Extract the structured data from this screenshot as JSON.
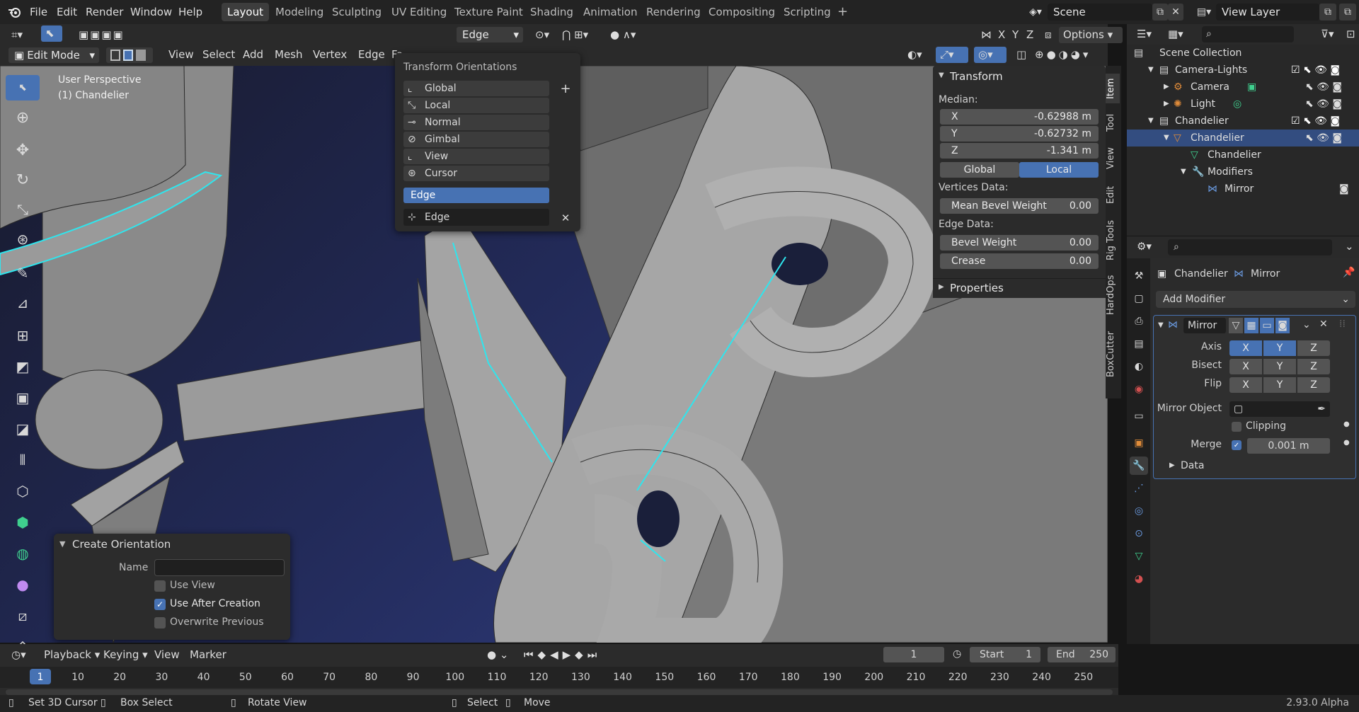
{
  "menu": {
    "items": [
      "File",
      "Edit",
      "Render",
      "Window",
      "Help"
    ]
  },
  "workspaces": [
    "Layout",
    "Modeling",
    "Sculpting",
    "UV Editing",
    "Texture Paint",
    "Shading",
    "Animation",
    "Rendering",
    "Compositing",
    "Scripting"
  ],
  "scene": {
    "label": "Scene",
    "view_layer": "View Layer"
  },
  "viewport_header": {
    "mode": "Edit Mode",
    "menus": [
      "View",
      "Select",
      "Add",
      "Mesh",
      "Vertex",
      "Edge",
      "Fa"
    ],
    "orientation": "Edge",
    "options": "Options",
    "axes": [
      "X",
      "Y",
      "Z"
    ]
  },
  "viewport_overlay": {
    "perspective": "User Perspective",
    "object": "(1) Chandelier"
  },
  "orientations_popup": {
    "title": "Transform Orientations",
    "items": [
      "Global",
      "Local",
      "Normal",
      "Gimbal",
      "View",
      "Cursor"
    ],
    "selected": "Edge",
    "custom_name": "Edge"
  },
  "create_orientation": {
    "title": "Create Orientation",
    "name_label": "Name",
    "name_value": "",
    "use_view": "Use View",
    "use_after_creation": "Use After Creation",
    "overwrite_previous": "Overwrite Previous",
    "use_view_checked": false,
    "use_after_creation_checked": true,
    "overwrite_previous_checked": false
  },
  "n_panel": {
    "transform_title": "Transform",
    "median": "Median:",
    "x_label": "X",
    "x_value": "-0.62988 m",
    "y_label": "Y",
    "y_value": "-0.62732 m",
    "z_label": "Z",
    "z_value": "-1.341 m",
    "global": "Global",
    "local": "Local",
    "vertices_data": "Vertices Data:",
    "mean_bevel_weight": "Mean Bevel Weight",
    "mean_bevel_weight_value": "0.00",
    "edge_data": "Edge Data:",
    "bevel_weight": "Bevel Weight",
    "bevel_weight_value": "0.00",
    "crease": "Crease",
    "crease_value": "0.00",
    "properties": "Properties",
    "tabs": [
      "Item",
      "Tool",
      "View",
      "Edit",
      "Rig Tools",
      "HardOps",
      "BoxCutter"
    ]
  },
  "outliner": {
    "root": "Scene Collection",
    "rows": [
      "Camera-Lights",
      "Camera",
      "Light",
      "Chandelier",
      "Chandelier",
      "Chandelier",
      "Modifiers",
      "Mirror"
    ]
  },
  "properties": {
    "object": "Chandelier",
    "modifier": "Mirror",
    "add_modifier": "Add Modifier",
    "modifier_name": "Mirror",
    "axis_label": "Axis",
    "bisect_label": "Bisect",
    "flip_label": "Flip",
    "axes": [
      "X",
      "Y",
      "Z"
    ],
    "axis_on": [
      true,
      true,
      false
    ],
    "mirror_object": "Mirror Object",
    "clipping": "Clipping",
    "merge": "Merge",
    "merge_value": "0.001 m",
    "data": "Data"
  },
  "timeline": {
    "menus": [
      "Playback",
      "Keying",
      "View",
      "Marker"
    ],
    "current_frame": "1",
    "start_label": "Start",
    "start": "1",
    "end_label": "End",
    "end": "250",
    "ticks": [
      "1",
      "10",
      "20",
      "30",
      "40",
      "50",
      "60",
      "70",
      "80",
      "90",
      "100",
      "110",
      "120",
      "130",
      "140",
      "150",
      "160",
      "170",
      "180",
      "190",
      "200",
      "210",
      "220",
      "230",
      "240",
      "250"
    ]
  },
  "statusbar": {
    "items": [
      "Set 3D Cursor",
      "Box Select",
      "Rotate View",
      "Select",
      "Move"
    ],
    "version": "2.93.0 Alpha"
  },
  "colors": {
    "accent": "#4772b3",
    "selection": "#2ee6ee"
  }
}
